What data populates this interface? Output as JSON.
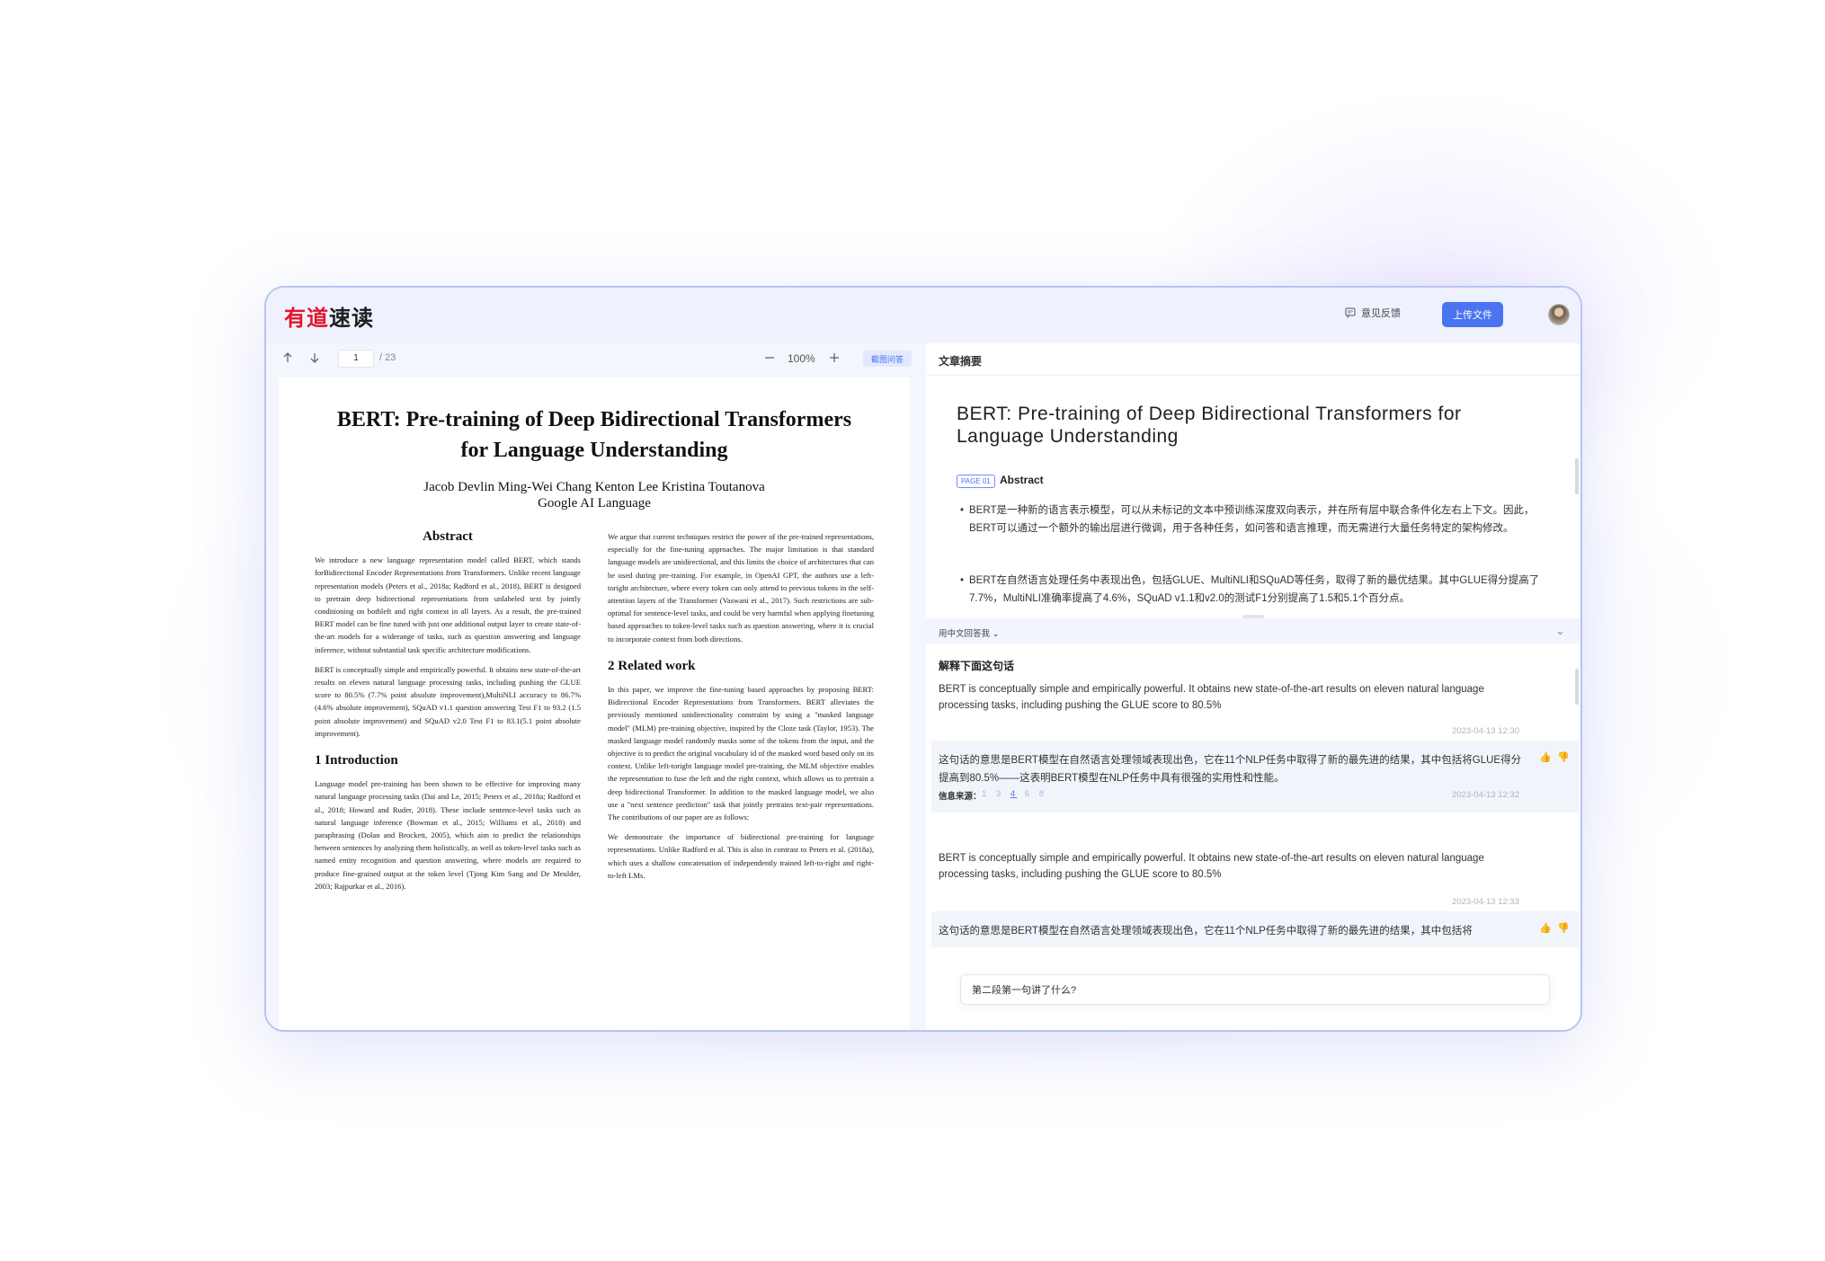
{
  "app": {
    "logo_part1": "有道",
    "logo_part2": "速读",
    "feedback_label": "意见反馈",
    "upload_label": "上传文件"
  },
  "pdf_toolbar": {
    "page_current": "1",
    "page_total": "/ 23",
    "zoom": "100%",
    "screenshot_qa": "截图问答"
  },
  "pdf": {
    "title_line1": "BERT: Pre-training of Deep Bidirectional Transformers",
    "title_line2": "for Language Understanding",
    "authors": "Jacob Devlin Ming-Wei Chang Kenton Lee Kristina Toutanova",
    "affiliation": "Google AI Language",
    "abstract_heading": "Abstract",
    "abstract_p1": "We introduce a new language representation model called BERT, which stands forBidirectional Encoder Representations from Transformers. Unlike recent language representation models (Peters et al., 2018a; Radford et al., 2018), BERT is designed to pretrain deep bidirectional representations from unlabeled text by jointly conditioning on bothleft and right context in all layers. As a result, the pre-trained BERT model can be fine tuned with just one additional output layer  to create state-of-the-art models for a widerange of tasks, such as question answering and language inference, without substantial task specific architecture modifications.",
    "abstract_p2": "BERT is conceptually simple and empirically powerful. It obtains new state-of-the-art results on eleven natural language processing tasks, including pushing the GLUE score to 80.5% (7.7% point absolute improvement),MultiNLI accuracy to 86.7% (4.6% absolute improvement), SQuAD v1.1 question answering Test F1 to 93.2 (1.5 point absolute improvement) and SQuAD v2.0 Test F1 to 83.1(5.1 point absolute improvement).",
    "intro_heading": "1 Introduction",
    "intro_p1": "Language model pre-training has been shown to be effective for improving many natural language processing tasks (Dai and Le, 2015; Peters et al., 2018a; Radford et al., 2018; Howard and Ruder, 2018). These include sentence-level tasks such as natural language inference (Bowman et al., 2015; Williams et al., 2018) and paraphrasing (Dolan and Brockett, 2005), which aim to predict the relationships between sentences by analyzing them holistically, as well as token-level tasks such as named entity recognition and question answering, where models are required to produce fine-grained output at the token level (Tjong Kim Sang and De Meulder, 2003; Rajpurkar et al., 2016).",
    "right_p1": "We argue that current techniques restrict the power of the pre-trained representations, especially for the fine-tuning approaches. The major limitation is that standard language models are unidirectional, and this limits the choice of architectures that can be used during pre-training. For example, in OpenAI GPT, the authors use a left-toright architecture, where every token can only attend to previous tokens in the self-attention layers of the Transformer (Vaswani et al., 2017). Such restrictions are sub-optimal for sentence-level tasks, and could be very harmful when applying finetuning based approaches to token-level tasks such as question answering, where it is crucial to incorporate context from both directions.",
    "related_heading": "2 Related work",
    "related_p1": "In this paper, we improve the fine-tuning based approaches by proposing BERT: Bidirectional Encoder Representations from Transformers. BERT alleviates the previously mentioned unidirectionality constraint by using a \"masked language model\" (MLM) pre-training objective, inspired by the Cloze task (Taylor, 1953). The masked language model randomly masks some of the tokens from the input, and the objective is to predict the original vocabulary id of the masked word based only on its context. Unlike left-toright language model pre-training, the MLM objective enables the representation to fuse the left and the right context, which allows us to pretrain a deep bidirectional Transformer. In addition to the masked language model, we also use a \"next sentence prediction\" task that jointly pretrains text-pair representations. The contributions of our paper are as follows:",
    "related_p2": "We demonstrate the importance of bidirectional pre-training for language representations. Unlike Radford et al. This is also in contrast to Peters et al. (2018a), which uses a shallow concatenation of independently trained left-to-right and right-to-left LMs."
  },
  "summary": {
    "header": "文章摘要",
    "title": "BERT: Pre-training of Deep Bidirectional Transformers for Language Understanding",
    "page_tag": "PAGE 01",
    "section": "Abstract",
    "bullets": [
      "BERT是一种新的语言表示模型，可以从未标记的文本中预训练深度双向表示，并在所有层中联合条件化左右上下文。因此，BERT可以通过一个额外的输出层进行微调，用于各种任务，如问答和语言推理，而无需进行大量任务特定的架构修改。",
      "BERT在自然语言处理任务中表现出色，包括GLUE、MultiNLI和SQuAD等任务，取得了新的最优结果。其中GLUE得分提高了7.7%，MultiNLI准确率提高了4.6%，SQuAD v1.1和v2.0的测试F1分别提高了1.5和5.1个百分点。"
    ]
  },
  "qa": {
    "mode": "用中文回答我 ⌄",
    "title": "解释下面这句话",
    "q1": "BERT is conceptually simple and empirically powerful. It obtains new state-of-the-art results on eleven natural language processing tasks, including pushing the GLUE score to 80.5%",
    "q1_time": "2023-04-13 12:30",
    "a1": "这句话的意思是BERT模型在自然语言处理领域表现出色，它在11个NLP任务中取得了新的最先进的结果，其中包括将GLUE得分提高到80.5%——这表明BERT模型在NLP任务中具有很强的实用性和性能。",
    "source_label": "信息来源：",
    "sources": [
      "1",
      "3",
      "4",
      "6",
      "8"
    ],
    "a1_time": "2023-04-13 12:32",
    "q2": "BERT is conceptually simple and empirically powerful. It obtains new state-of-the-art results on eleven natural language processing tasks, including pushing the GLUE score to 80.5%",
    "q2_time": "2023-04-13 12:33",
    "a2": "这句话的意思是BERT模型在自然语言处理领域表现出色，它在11个NLP任务中取得了新的最先进的结果，其中包括将",
    "input_value": "第二段第一句讲了什么?"
  },
  "icons": [
    "arrow-up-icon",
    "arrow-down-icon",
    "zoom-out-icon",
    "zoom-in-icon",
    "feedback-icon",
    "thumb-up-icon",
    "thumb-down-icon",
    "chevron-down-icon"
  ],
  "colors": {
    "accent": "#4b74f2",
    "logo_red": "#e0172b",
    "border": "#b8c3f6"
  }
}
